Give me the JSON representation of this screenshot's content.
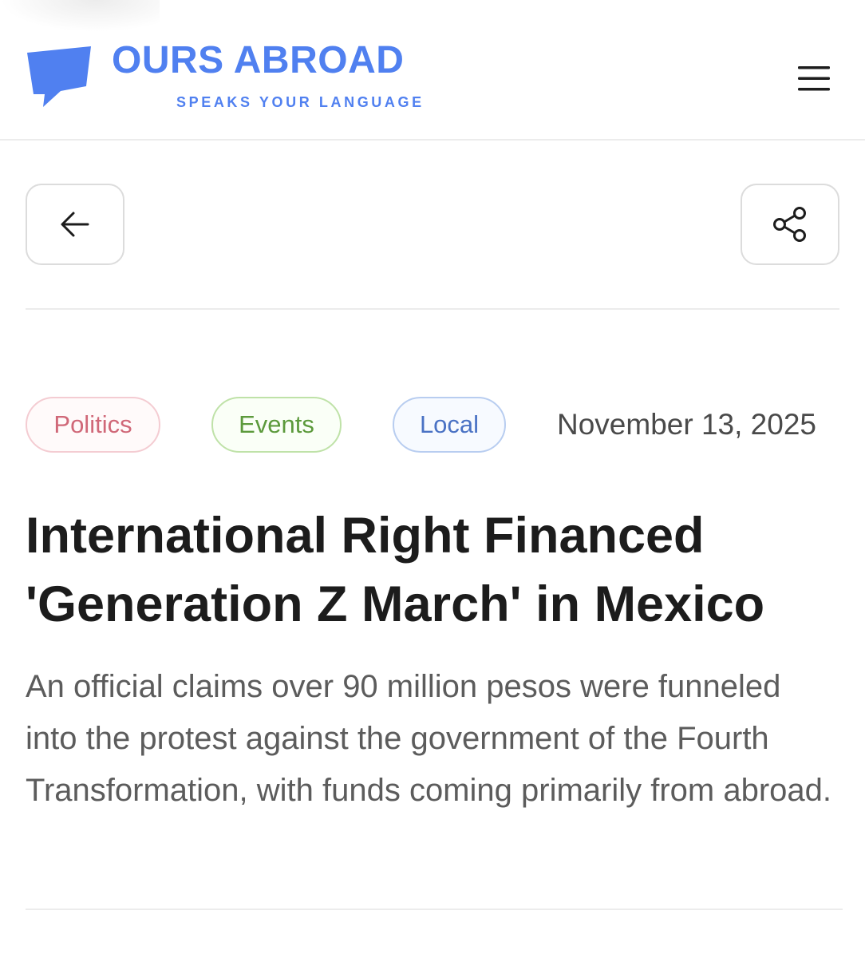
{
  "brand": {
    "title": "OURS ABROAD",
    "tagline": "SPEAKS YOUR LANGUAGE",
    "logo_icon": "speech-bubble-icon",
    "accent_color": "#5080f0"
  },
  "header": {
    "menu_icon": "hamburger-menu-icon"
  },
  "toolbar": {
    "back_icon": "arrow-left-icon",
    "share_icon": "share-icon"
  },
  "article": {
    "tags": [
      {
        "label": "Politics",
        "color": "#d06878"
      },
      {
        "label": "Events",
        "color": "#5c9a3c"
      },
      {
        "label": "Local",
        "color": "#4a72c4"
      }
    ],
    "date": "November 13, 2025",
    "headline": "International Right Financed 'Generation Z March' in Mexico",
    "summary": "An official claims over 90 million pesos were funneled into the protest against the government of the Fourth Transformation, with funds coming primarily from abroad."
  }
}
